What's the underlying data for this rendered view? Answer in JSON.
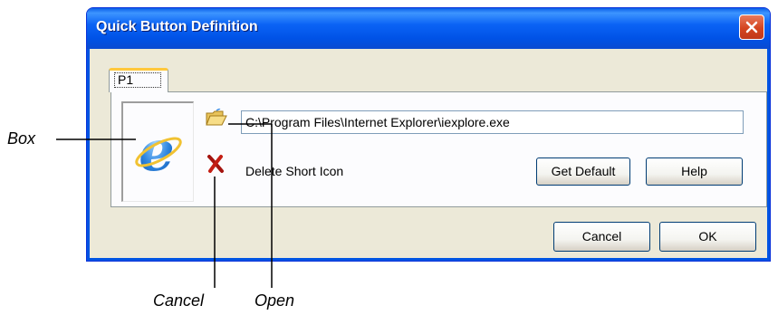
{
  "dialog": {
    "title": "Quick Button Definition",
    "close_icon": "close-icon",
    "accent_color": "#0054e3"
  },
  "tabs": [
    {
      "label": "P1",
      "selected": true
    }
  ],
  "panel": {
    "program_icon": "internet-explorer-icon",
    "open_icon": "open-folder-icon",
    "path_value": "C:\\Program Files\\Internet Explorer\\iexplore.exe",
    "delete_icon": "red-x-icon",
    "delete_label": "Delete Short Icon",
    "get_default_label": "Get Default",
    "help_label": "Help"
  },
  "footer": {
    "cancel_label": "Cancel",
    "ok_label": "OK"
  },
  "callouts": {
    "box": "Box",
    "cancel": "Cancel",
    "open": "Open"
  }
}
